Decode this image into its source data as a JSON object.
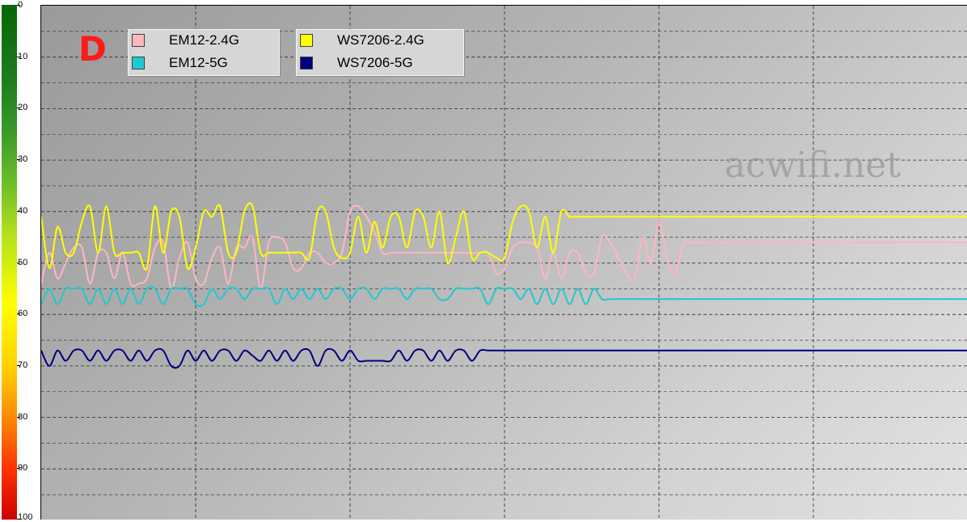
{
  "panel_letter": "D",
  "watermark": "acwifi.net",
  "colors": {
    "EM12-2.4G": "#ffb6c1",
    "EM12-5G": "#20c8d0",
    "WS7206-2.4G": "#ffff00",
    "WS7206-5G": "#000080"
  },
  "chart_data": {
    "type": "line",
    "title": "",
    "xlabel": "",
    "ylabel": "",
    "ylim": [
      0,
      100
    ],
    "y_inverted": true,
    "y_ticks": [
      "0",
      "10",
      "20",
      "30",
      "40",
      "50",
      "60",
      "70",
      "80",
      "90",
      "100"
    ],
    "grid": true,
    "legend": [
      "EM12-2.4G",
      "EM12-5G",
      "WS7206-2.4G",
      "WS7206-5G"
    ],
    "legend_position": "top-left",
    "x": [
      0,
      10,
      20,
      30,
      40,
      50,
      60,
      70,
      80,
      90,
      100,
      110,
      120,
      130,
      140,
      150,
      160,
      170,
      180,
      190,
      200,
      210,
      220,
      230,
      240,
      250,
      260,
      270,
      280,
      290,
      300,
      310,
      320,
      330,
      340,
      350,
      360,
      370,
      380,
      390,
      400,
      410,
      420,
      430,
      440,
      450,
      460,
      470,
      480,
      490,
      500,
      510,
      520,
      530,
      540,
      550,
      560,
      570,
      580,
      590,
      600,
      610,
      620,
      630,
      640,
      650,
      660,
      670,
      680,
      690,
      700,
      710,
      720,
      730,
      740,
      750,
      760,
      770,
      780,
      790,
      800,
      810,
      820,
      830,
      840,
      850,
      860,
      870,
      880,
      890,
      900,
      910,
      920,
      930,
      940,
      950,
      960,
      970,
      980,
      990,
      1000,
      1010,
      1020,
      1030,
      1040,
      1050,
      1060,
      1070,
      1080,
      1090,
      1100,
      1110,
      1120,
      1130,
      1140
    ],
    "series": [
      {
        "name": "EM12-2.4G",
        "values": [
          54,
          48,
          53,
          50,
          47,
          47,
          54,
          48,
          48,
          53,
          48,
          54,
          54,
          53,
          47,
          46,
          55,
          49,
          46,
          53,
          54,
          49,
          47,
          54,
          47,
          47,
          45,
          55,
          46,
          45,
          46,
          51,
          51,
          48,
          48,
          50,
          50,
          48,
          40,
          39,
          41,
          44,
          48,
          48,
          48,
          48,
          48,
          48,
          48,
          48,
          48,
          48,
          48,
          48,
          48,
          48,
          52,
          51,
          47,
          46,
          46,
          47,
          53,
          48,
          53,
          48,
          48,
          52,
          52,
          45,
          46,
          49,
          52,
          53,
          45,
          50,
          42,
          49,
          52,
          46,
          46,
          46,
          46,
          46,
          46,
          46,
          46,
          46,
          46,
          46,
          46,
          46,
          46,
          46,
          46,
          46,
          46,
          46,
          46,
          46,
          46,
          46,
          46,
          46,
          46,
          46,
          46,
          46,
          46,
          46,
          46,
          46,
          46,
          46,
          46
        ]
      },
      {
        "name": "EM12-5G",
        "values": [
          58,
          55,
          58,
          55,
          55,
          55,
          58,
          55,
          58,
          55,
          58,
          55,
          58,
          55,
          55,
          58,
          55,
          55,
          55,
          58,
          58,
          55,
          57,
          55,
          55,
          57,
          55,
          55,
          55,
          58,
          55,
          57,
          55,
          57,
          55,
          57,
          55,
          55,
          57,
          55,
          55,
          57,
          55,
          55,
          55,
          57,
          55,
          55,
          55,
          57,
          57,
          55,
          55,
          55,
          55,
          58,
          55,
          55,
          55,
          57,
          55,
          58,
          55,
          58,
          55,
          58,
          55,
          58,
          55,
          57,
          57,
          57,
          57,
          57,
          57,
          57,
          57,
          57,
          57,
          57,
          57,
          57,
          57,
          57,
          57,
          57,
          57,
          57,
          57,
          57,
          57,
          57,
          57,
          57,
          57,
          57,
          57,
          57,
          57,
          57,
          57,
          57,
          57,
          57,
          57,
          57,
          57,
          57,
          57,
          57,
          57,
          57,
          57,
          57,
          57
        ]
      },
      {
        "name": "WS7206-2.4G",
        "values": [
          41,
          51,
          43,
          48,
          48,
          42,
          39,
          48,
          39,
          48,
          48,
          48,
          48,
          51,
          39,
          48,
          40,
          41,
          51,
          47,
          40,
          41,
          39,
          48,
          48,
          40,
          39,
          48,
          48,
          48,
          48,
          48,
          48,
          49,
          40,
          40,
          47,
          49,
          48,
          41,
          48,
          42,
          47,
          41,
          41,
          47,
          40,
          41,
          47,
          40,
          50,
          45,
          40,
          49,
          48,
          48,
          49,
          49,
          42,
          39,
          40,
          47,
          41,
          48,
          40,
          41,
          41,
          41,
          41,
          41,
          41,
          41,
          41,
          41,
          41,
          41,
          41,
          41,
          41,
          41,
          41,
          41,
          41,
          41,
          41,
          41,
          41,
          41,
          41,
          41,
          41,
          41,
          41,
          41,
          41,
          41,
          41,
          41,
          41,
          41,
          41,
          41,
          41,
          41,
          41,
          41,
          41,
          41,
          41,
          41,
          41,
          41,
          41,
          41,
          41
        ]
      },
      {
        "name": "WS7206-5G",
        "values": [
          67,
          70,
          67,
          69,
          67,
          67,
          69,
          67,
          69,
          67,
          67,
          69,
          67,
          69,
          67,
          67,
          70,
          70,
          67,
          69,
          67,
          69,
          67,
          67,
          69,
          67,
          68,
          69,
          67,
          69,
          67,
          69,
          67,
          67,
          70,
          67,
          67,
          69,
          67,
          69,
          69,
          69,
          69,
          69,
          67,
          69,
          67,
          67,
          69,
          67,
          69,
          67,
          67,
          69,
          67,
          67,
          67,
          67,
          67,
          67,
          67,
          67,
          67,
          67,
          67,
          67,
          67,
          67,
          67,
          67,
          67,
          67,
          67,
          67,
          67,
          67,
          67,
          67,
          67,
          67,
          67,
          67,
          67,
          67,
          67,
          67,
          67,
          67,
          67,
          67,
          67,
          67,
          67,
          67,
          67,
          67,
          67,
          67,
          67,
          67,
          67,
          67,
          67,
          67,
          67,
          67,
          67,
          67,
          67,
          67,
          67,
          67,
          67,
          67,
          67
        ]
      }
    ]
  }
}
